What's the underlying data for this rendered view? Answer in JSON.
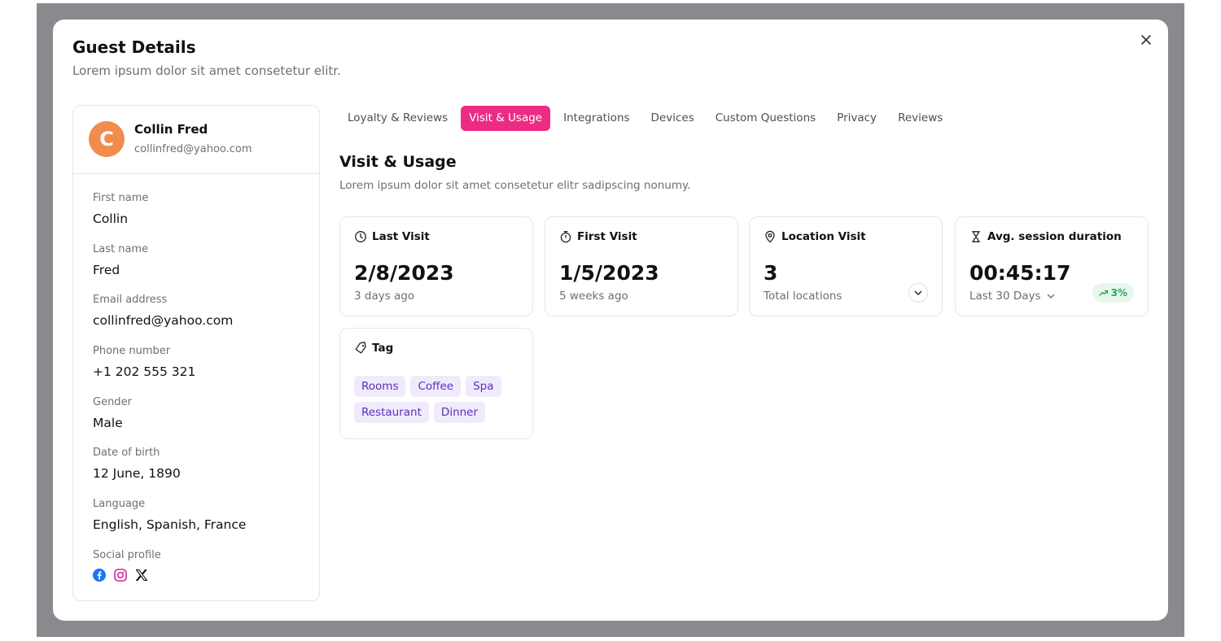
{
  "modal": {
    "title": "Guest Details",
    "subtitle": "Lorem ipsum dolor sit amet consetetur elitr."
  },
  "profile": {
    "initial": "C",
    "avatar_color": "#f28b4e",
    "name": "Collin Fred",
    "email": "collinfred@yahoo.com",
    "fields": [
      {
        "label": "First name",
        "value": "Collin"
      },
      {
        "label": "Last name",
        "value": "Fred"
      },
      {
        "label": "Email address",
        "value": "collinfred@yahoo.com"
      },
      {
        "label": "Phone number",
        "value": "+1 202 555 321"
      },
      {
        "label": "Gender",
        "value": "Male"
      },
      {
        "label": "Date of birth",
        "value": "12 June, 1890"
      },
      {
        "label": "Language",
        "value": "English, Spanish, France"
      }
    ],
    "social_label": "Social profile",
    "social_icons": [
      "facebook-icon",
      "instagram-icon",
      "x-icon"
    ]
  },
  "tabs": [
    "Loyalty & Reviews",
    "Visit & Usage",
    "Integrations",
    "Devices",
    "Custom Questions",
    "Privacy",
    "Reviews"
  ],
  "active_tab": "Visit & Usage",
  "accent_color": "#ec2c84",
  "section": {
    "title": "Visit & Usage",
    "subtitle": "Lorem ipsum dolor sit amet consetetur elitr sadipscing nonumy."
  },
  "cards": {
    "last_visit": {
      "label": "Last Visit",
      "value": "2/8/2023",
      "sub": "3 days ago",
      "icon": "clock-icon"
    },
    "first_visit": {
      "label": "First Visit",
      "value": "1/5/2023",
      "sub": "5 weeks ago",
      "icon": "stopwatch-icon"
    },
    "location_visit": {
      "label": "Location Visit",
      "value": "3",
      "sub": "Total locations",
      "icon": "map-pin-icon"
    },
    "avg_session": {
      "label": "Avg. session duration",
      "value": "00:45:17",
      "sub": "Last 30 Days",
      "trend": "3%",
      "trend_color": "#27a55a",
      "icon": "hourglass-icon"
    },
    "tag": {
      "label": "Tag",
      "icon": "tag-icon",
      "tags": [
        "Rooms",
        "Coffee",
        "Spa",
        "Restaurant",
        "Dinner"
      ]
    }
  }
}
